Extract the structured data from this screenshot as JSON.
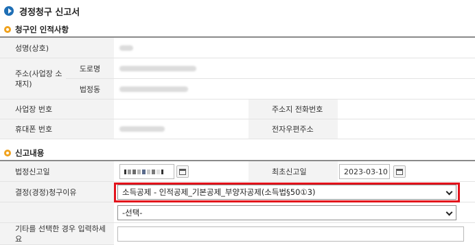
{
  "page": {
    "title": "경정청구 신고서"
  },
  "sections": {
    "claimant": {
      "title": "청구인 인적사항",
      "labels": {
        "name": "성명(상호)",
        "address": "주소(사업장 소재지)",
        "road": "도로명",
        "lot": "법정동",
        "business_no": "사업장 번호",
        "address_phone": "주소지 전화번호",
        "mobile": "휴대폰 번호",
        "email": "전자우편주소"
      }
    },
    "report": {
      "title": "신고내용",
      "labels": {
        "legal_date": "법정신고일",
        "first_date": "최초신고일",
        "reason": "결정(경정)청구이유",
        "other_input": "기타를 선택한 경우 입력하세요"
      },
      "first_date_value": "2023-03-10",
      "reason_selected": "소득공제 - 인적공제_기본공제_부양자공제(소득법§50①3)",
      "sub_reason_selected": "-선택-"
    }
  },
  "colors": {
    "highlight": "#e3121b",
    "accent_blue": "#1f6fb5",
    "section_dot": "#f0a21e"
  }
}
